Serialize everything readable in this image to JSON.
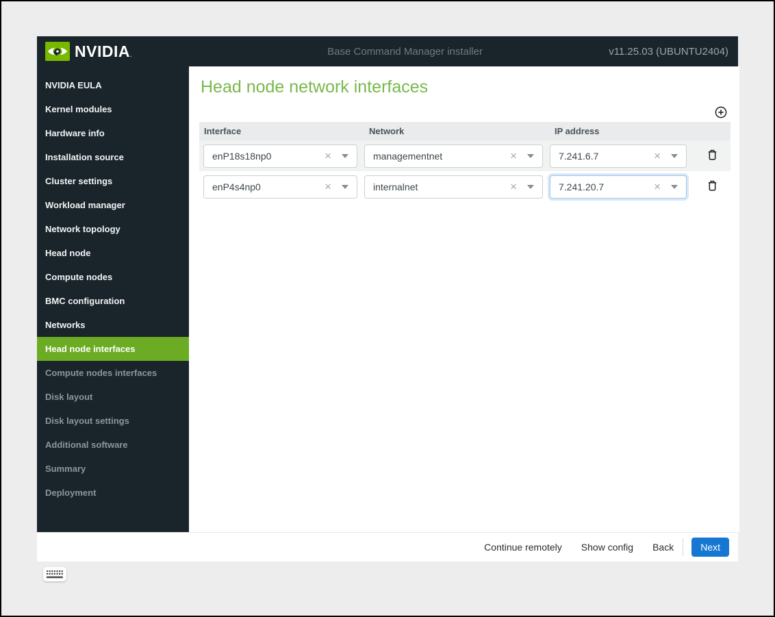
{
  "colors": {
    "header_dark": "#19242b",
    "nvidia_green": "#76b900",
    "active_item_green": "#6cac24",
    "title_green": "#79b84a",
    "next_blue": "#1677d3",
    "focus_blue": "#9ec7ea"
  },
  "header": {
    "logo_text": "NVIDIA",
    "title": "Base Command Manager installer",
    "version": "v11.25.03 (UBUNTU2404)"
  },
  "sidebar": {
    "items": [
      {
        "label": "NVIDIA EULA",
        "state": "done"
      },
      {
        "label": "Kernel modules",
        "state": "done"
      },
      {
        "label": "Hardware info",
        "state": "done"
      },
      {
        "label": "Installation source",
        "state": "done"
      },
      {
        "label": "Cluster settings",
        "state": "done"
      },
      {
        "label": "Workload manager",
        "state": "done"
      },
      {
        "label": "Network topology",
        "state": "done"
      },
      {
        "label": "Head node",
        "state": "done"
      },
      {
        "label": "Compute nodes",
        "state": "done"
      },
      {
        "label": "BMC configuration",
        "state": "done"
      },
      {
        "label": "Networks",
        "state": "done"
      },
      {
        "label": "Head node interfaces",
        "state": "active"
      },
      {
        "label": "Compute nodes interfaces",
        "state": "upcoming"
      },
      {
        "label": "Disk layout",
        "state": "upcoming"
      },
      {
        "label": "Disk layout settings",
        "state": "upcoming"
      },
      {
        "label": "Additional software",
        "state": "upcoming"
      },
      {
        "label": "Summary",
        "state": "upcoming"
      },
      {
        "label": "Deployment",
        "state": "upcoming"
      }
    ]
  },
  "main": {
    "title": "Head node network interfaces",
    "table": {
      "columns": [
        "Interface",
        "Network",
        "IP address"
      ],
      "rows": [
        {
          "interface": "enP18s18np0",
          "network": "managementnet",
          "ip": "7.241.6.7",
          "ip_focused": false
        },
        {
          "interface": "enP4s4np0",
          "network": "internalnet",
          "ip": "7.241.20.7",
          "ip_focused": true
        }
      ]
    }
  },
  "footer": {
    "actions": [
      "Continue remotely",
      "Show config",
      "Back"
    ],
    "next": "Next"
  },
  "icons": {
    "add_row": "plus-circle",
    "delete_row": "trash",
    "clear": "×",
    "dropdown": "caret-down",
    "keyboard": "keyboard"
  }
}
